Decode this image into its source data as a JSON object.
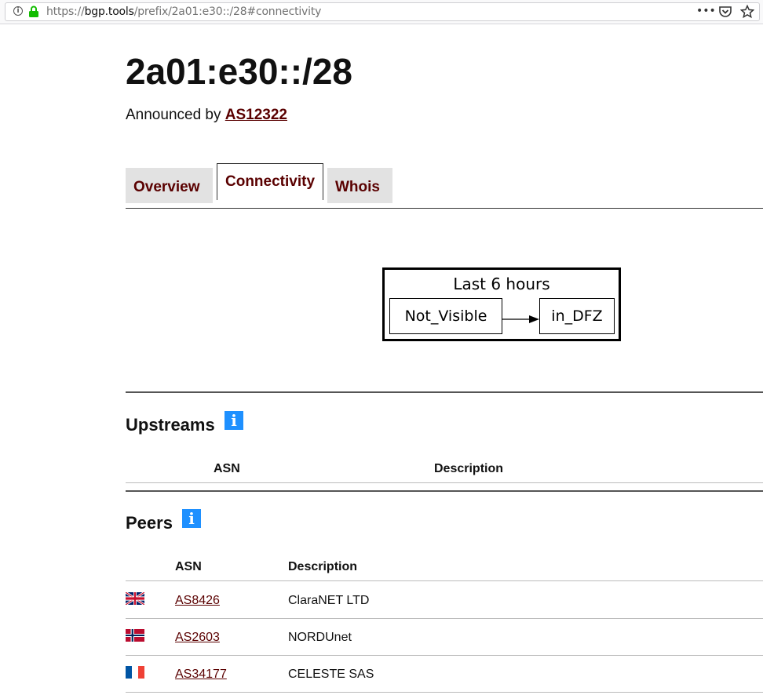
{
  "browser": {
    "url_scheme": "https://",
    "url_host": "bgp.tools",
    "url_path": "/prefix/2a01:e30::/28#connectivity",
    "icons": [
      "site-info-icon",
      "lock-icon",
      "more-icon",
      "pocket-icon",
      "bookmark-star-icon"
    ]
  },
  "page": {
    "title": "2a01:e30::/28",
    "announced_prefix": "Announced by ",
    "announced_asn": "AS12322"
  },
  "tabs": [
    {
      "label": "Overview",
      "active": false
    },
    {
      "label": "Connectivity",
      "active": true
    },
    {
      "label": "Whois",
      "active": false
    }
  ],
  "graph": {
    "title": "Last 6 hours",
    "from": "Not_Visible",
    "to": "in_DFZ"
  },
  "upstreams": {
    "heading": "Upstreams",
    "columns": [
      "ASN",
      "Description"
    ],
    "rows": []
  },
  "peers": {
    "heading": "Peers",
    "columns": [
      "ASN",
      "Description"
    ],
    "rows": [
      {
        "flag": "gb",
        "asn": "AS8426",
        "description": "ClaraNET LTD"
      },
      {
        "flag": "no",
        "asn": "AS2603",
        "description": "NORDUnet"
      },
      {
        "flag": "fr",
        "asn": "AS34177",
        "description": "CELESTE SAS"
      }
    ]
  },
  "colors": {
    "link": "#5a0000",
    "info_badge": "#1e90ff",
    "tab_inactive_bg": "#e2e2e2"
  }
}
